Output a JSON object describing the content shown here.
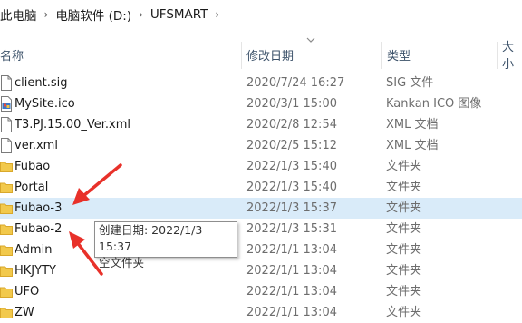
{
  "breadcrumb": {
    "items": [
      "此电脑",
      "电脑软件 (D:)",
      "UFSMART"
    ],
    "separator": "›"
  },
  "columns": {
    "name": "名称",
    "date": "修改日期",
    "type": "类型",
    "size": "大小"
  },
  "files": [
    {
      "name": "client.sig",
      "date": "2020/7/24 16:27",
      "type": "SIG 文件",
      "icon": "file-icon"
    },
    {
      "name": "MySite.ico",
      "date": "2020/3/1 15:00",
      "type": "Kankan ICO 图像",
      "icon": "ico-image-icon"
    },
    {
      "name": "T3.PJ.15.00_Ver.xml",
      "date": "2020/2/8 12:54",
      "type": "XML 文档",
      "icon": "file-icon"
    },
    {
      "name": "ver.xml",
      "date": "2020/2/5 15:12",
      "type": "XML 文档",
      "icon": "file-icon"
    },
    {
      "name": "Fubao",
      "date": "2022/1/3 15:40",
      "type": "文件夹",
      "icon": "folder-icon"
    },
    {
      "name": "Portal",
      "date": "2022/1/3 15:40",
      "type": "文件夹",
      "icon": "folder-icon"
    },
    {
      "name": "Fubao-3",
      "date": "2022/1/3 15:37",
      "type": "文件夹",
      "icon": "folder-icon",
      "selected": true
    },
    {
      "name": "Fubao-2",
      "date": "2022/1/3 15:31",
      "type": "文件夹",
      "icon": "folder-icon"
    },
    {
      "name": "Admin",
      "date": "2022/1/1 13:04",
      "type": "文件夹",
      "icon": "folder-icon"
    },
    {
      "name": "HKJYTY",
      "date": "2022/1/1 13:04",
      "type": "文件夹",
      "icon": "folder-icon"
    },
    {
      "name": "UFO",
      "date": "2022/1/1 13:04",
      "type": "文件夹",
      "icon": "folder-icon"
    },
    {
      "name": "ZW",
      "date": "2022/1/1 13:04",
      "type": "文件夹",
      "icon": "folder-icon"
    }
  ],
  "tooltip": {
    "line1": "创建日期: 2022/1/3 15:37",
    "line2": "空文件夹"
  },
  "colors": {
    "selected_row": "#d9ebf9",
    "annotation_arrow": "#e8312a",
    "folder": "#f2c94c"
  }
}
